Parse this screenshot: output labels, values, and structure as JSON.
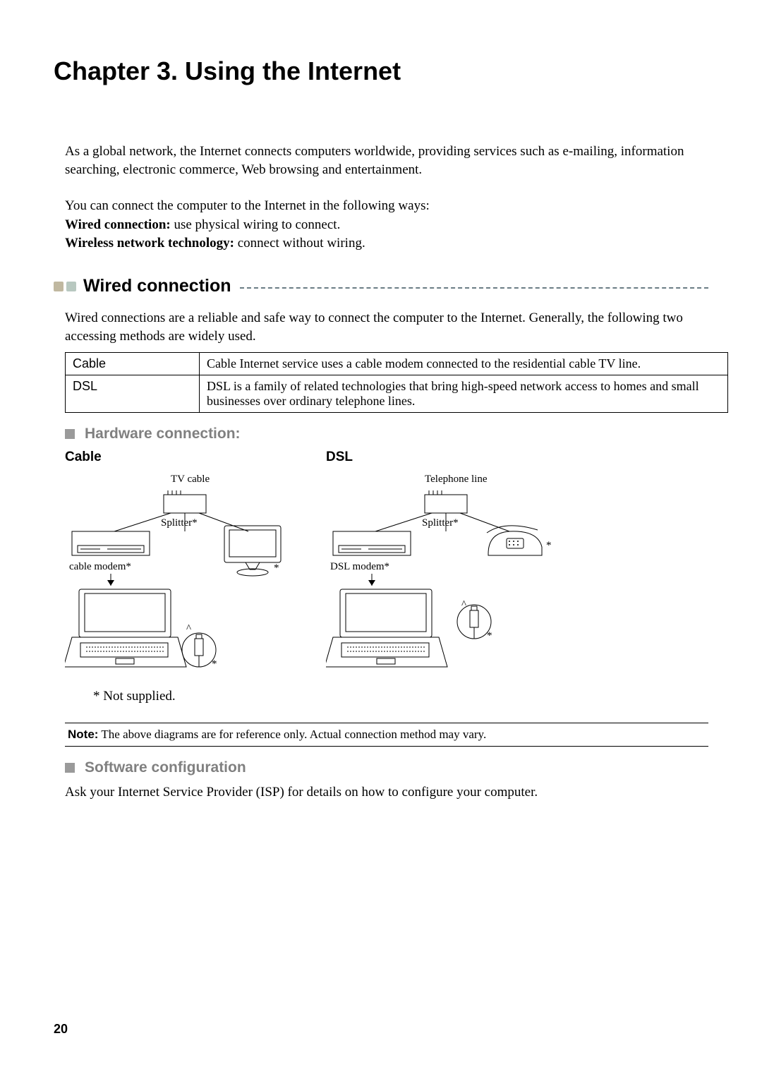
{
  "chapter_title": "Chapter 3. Using the Internet",
  "intro": {
    "p1": "As a global network, the Internet connects computers worldwide, providing services such as e-mailing, information searching, electronic commerce, Web browsing and entertainment."
  },
  "ways": {
    "lead": "You can connect the computer to the Internet in the following ways:",
    "wired_label": "Wired connection:",
    "wired_rest": " use physical wiring to connect.",
    "wireless_label": "Wireless network technology:",
    "wireless_rest": " connect without wiring."
  },
  "section_wired": {
    "title": "Wired connection",
    "body": "Wired connections are a reliable and safe way to connect the computer to the Internet. Generally, the following two accessing methods are widely used."
  },
  "table": {
    "rows": [
      {
        "key": "Cable",
        "desc": "Cable Internet service uses a cable modem connected to the residential cable TV line."
      },
      {
        "key": "DSL",
        "desc": "DSL is a family of related technologies that bring high-speed network access to homes and small businesses over ordinary telephone lines."
      }
    ]
  },
  "sub_hardware": "Hardware connection:",
  "diagram": {
    "cable_title": "Cable",
    "dsl_title": "DSL",
    "labels": {
      "tv_cable": "TV cable",
      "telephone_line": "Telephone line",
      "splitter": "Splitter*",
      "cable_modem": "cable modem*",
      "dsl_modem": "DSL modem*",
      "asterisk": "*"
    },
    "footnote": "* Not supplied."
  },
  "note": {
    "label": "Note:",
    "text": " The above diagrams are for reference only. Actual connection method may vary."
  },
  "sub_software": "Software configuration",
  "software_body": "Ask your Internet Service Provider (ISP) for details on how to configure your computer.",
  "page_number": "20"
}
